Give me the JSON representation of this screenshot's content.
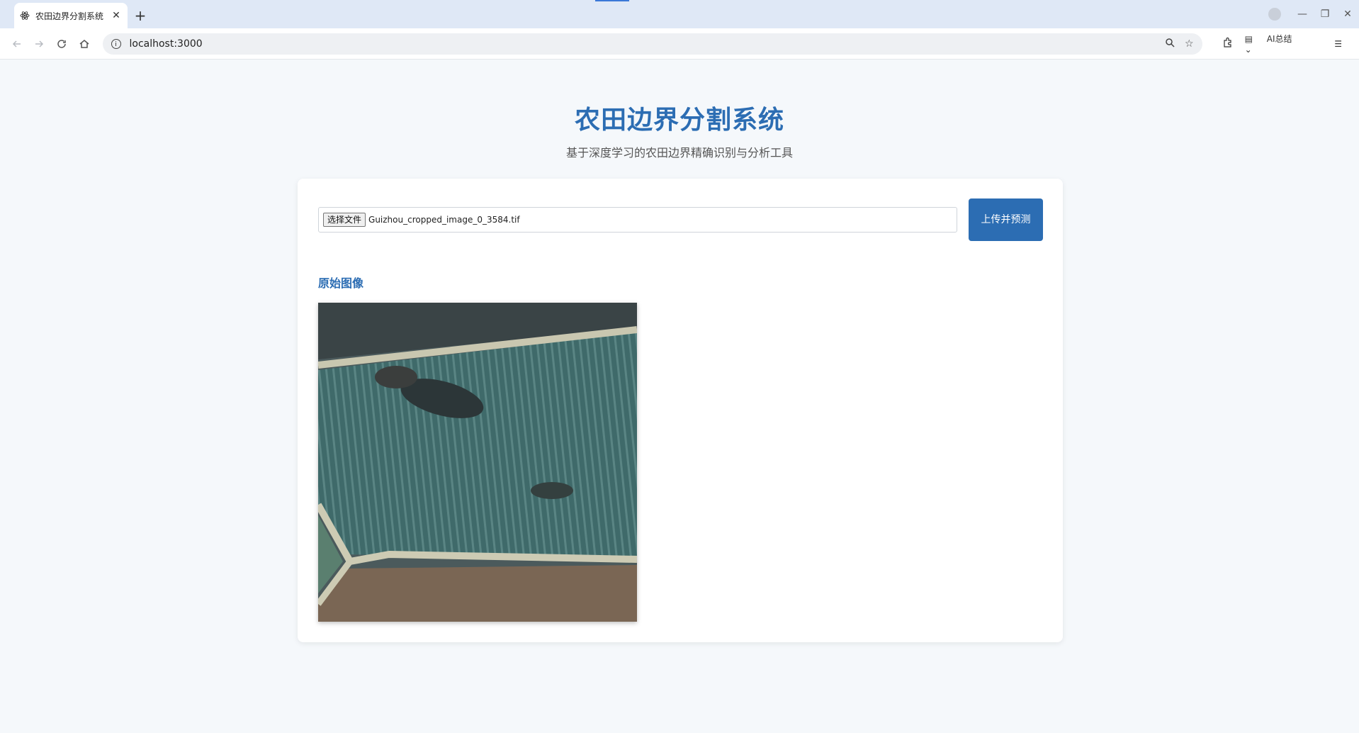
{
  "browser": {
    "tab_title": "农田边界分割系统",
    "tab_close": "✕",
    "new_tab": "+",
    "url": "localhost:3000",
    "ai_summary_label": "AI总结",
    "icons": [
      "back-icon",
      "forward-icon",
      "reload-icon",
      "home-icon",
      "info-icon",
      "zoom-icon",
      "star-icon",
      "extensions-icon",
      "reader-icon",
      "menu-icon"
    ]
  },
  "header": {
    "title": "农田边界分割系统",
    "subtitle": "基于深度学习的农田边界精确识别与分析工具"
  },
  "upload": {
    "choose_label": "选择文件",
    "file_name": "Guizhou_cropped_image_0_3584.tif",
    "submit_label": "上传并预测"
  },
  "original": {
    "section_title": "原始图像"
  },
  "colors": {
    "accent": "#2c6db3",
    "page_bg": "#f5f8fb"
  }
}
